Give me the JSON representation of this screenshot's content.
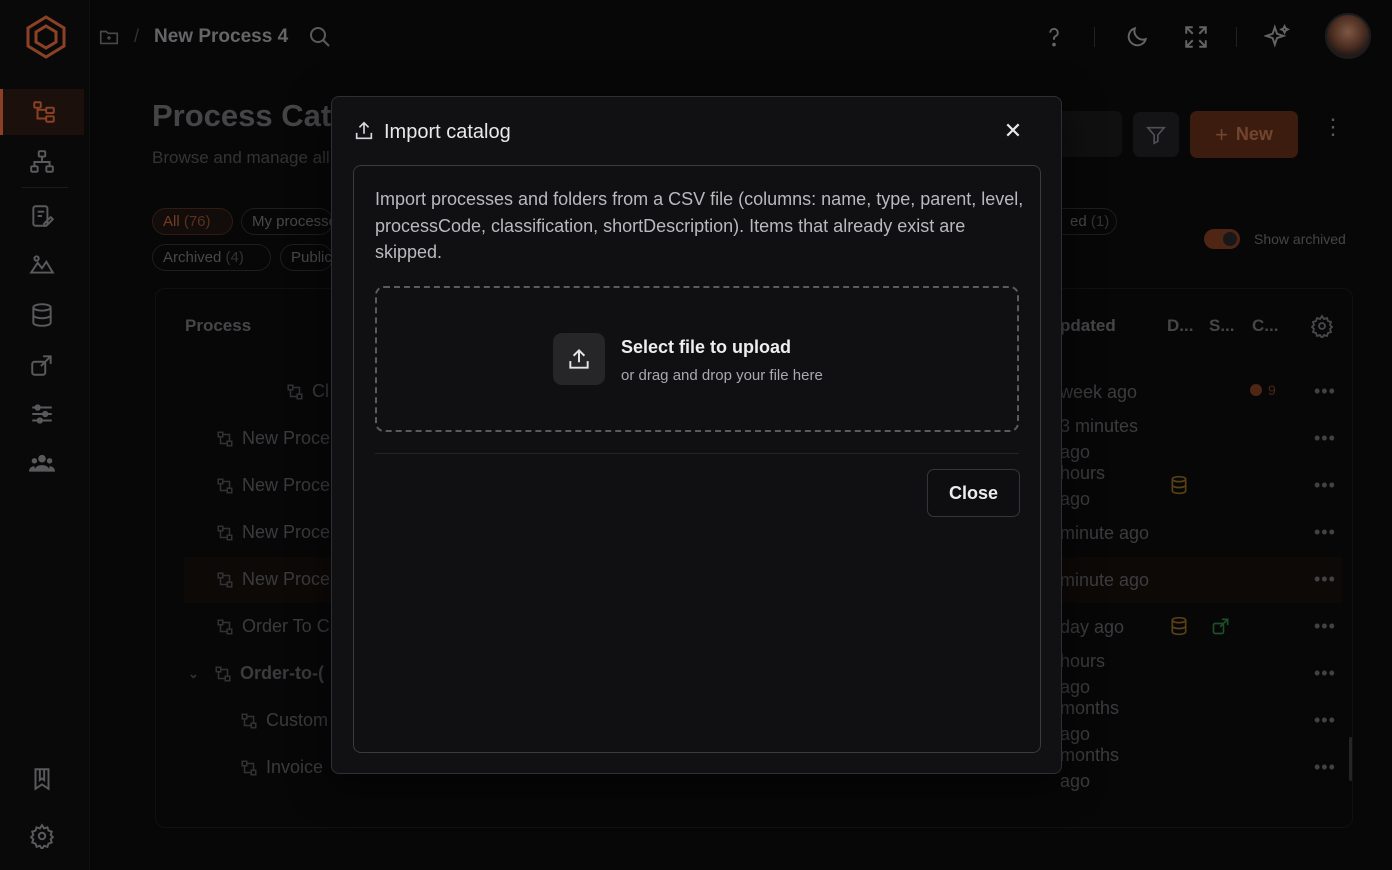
{
  "topbar": {
    "breadcrumb_title": "New Process 4"
  },
  "page": {
    "title": "Process Catalog",
    "subtitle": "Browse and manage all processes",
    "new_button": "New",
    "show_archived_label": "Show archived",
    "filters": [
      {
        "label": "All",
        "count": "(76)"
      },
      {
        "label": "My processes",
        "count": ""
      },
      {
        "label": "ed",
        "count": "(1)"
      },
      {
        "label": "Archived",
        "count": "(4)"
      },
      {
        "label": "Public",
        "count": ""
      }
    ]
  },
  "table": {
    "headers": {
      "process": "Process",
      "updated": "pdated",
      "d": "D...",
      "s": "S...",
      "c": "C..."
    },
    "rows": [
      {
        "name": "Cl",
        "time": "week ago"
      },
      {
        "name": "New Proce",
        "time": "3 minutes\nago"
      },
      {
        "name": "New Proce",
        "time": "hours\nago"
      },
      {
        "name": "New Proce",
        "time": "minute ago"
      },
      {
        "name": "New Proce",
        "time": "minute ago"
      },
      {
        "name": "Order To C",
        "time": "day ago"
      },
      {
        "name": "Order-to-(",
        "time": "hours\nago"
      },
      {
        "name": "Custom",
        "time": "months\nago"
      },
      {
        "name": "Invoice",
        "time": "months\nago"
      }
    ],
    "badge_count": "9"
  },
  "modal": {
    "title": "Import catalog",
    "description": "Import processes and folders from a CSV file (columns: name, type, parent, level, processCode, classification, shortDescription). Items that already exist are skipped.",
    "dropzone_title": "Select file to upload",
    "dropzone_subtitle": "or drag and drop your file here",
    "close_button": "Close"
  },
  "colors": {
    "accent": "#d7653a",
    "modal_bg": "#111113"
  }
}
